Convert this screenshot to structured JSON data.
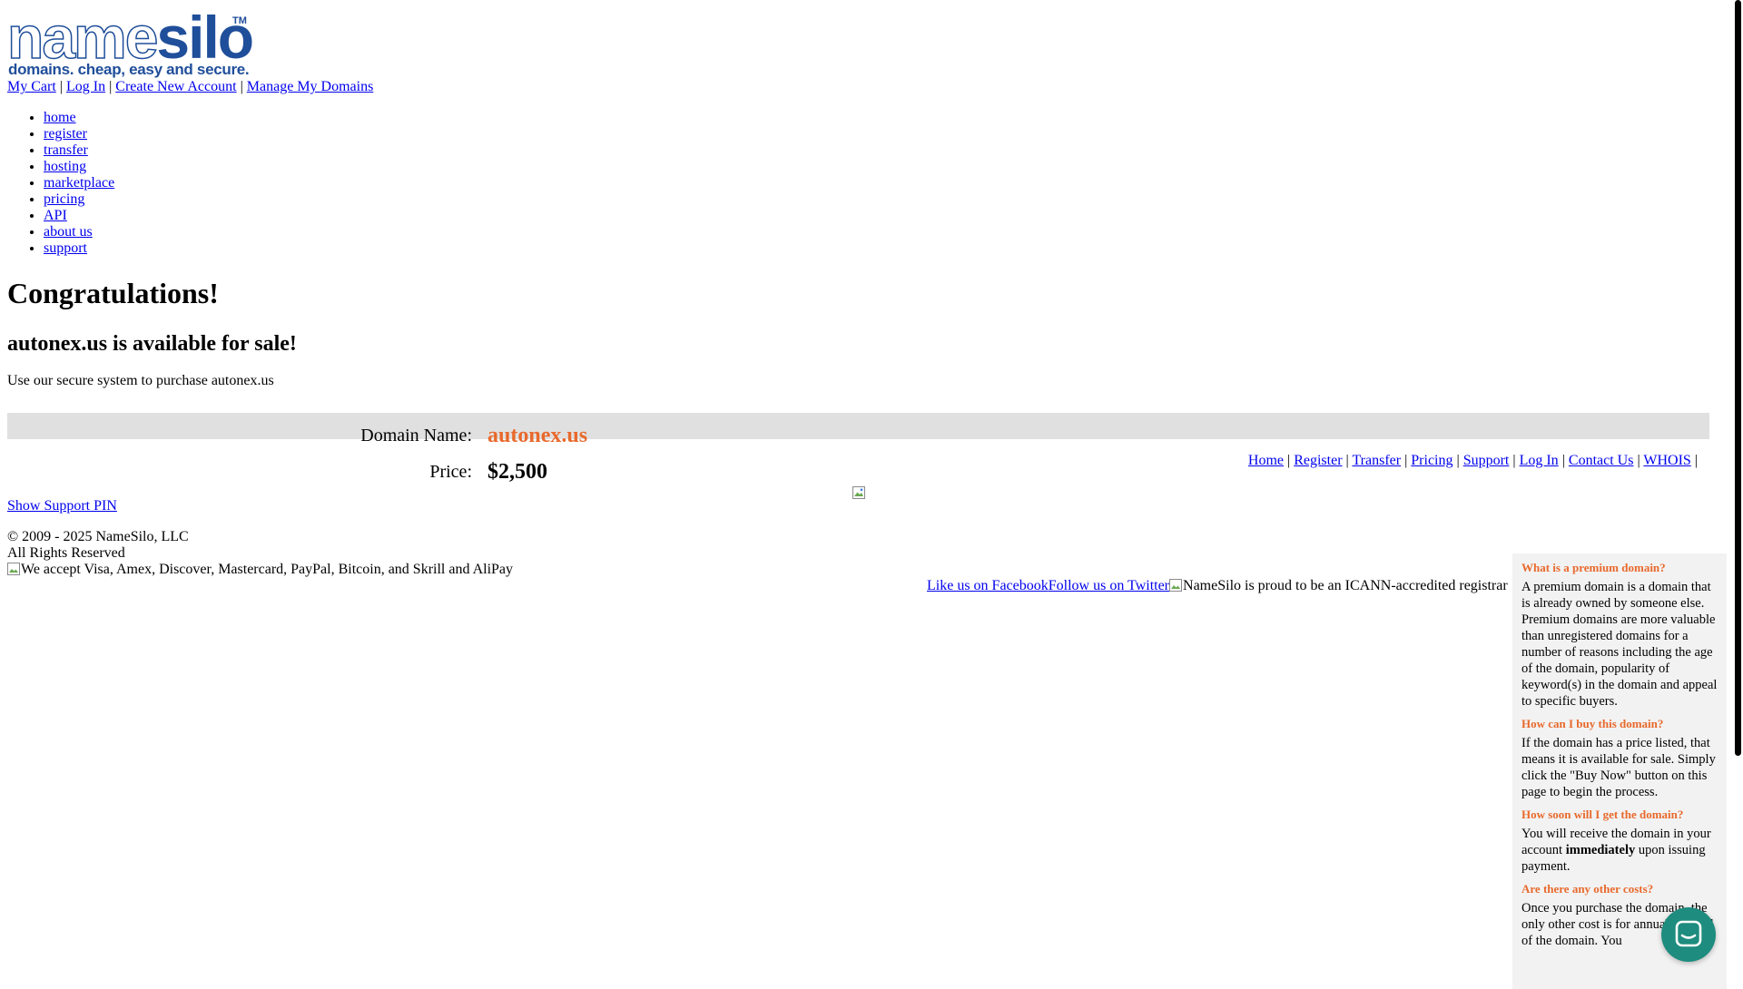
{
  "logo": {
    "wordmark_a": "name",
    "wordmark_b": "silo",
    "trademark": "TM",
    "tagline": "domains. cheap, easy and secure."
  },
  "top_nav": {
    "items": [
      "My Cart",
      "Log In",
      "Create New Account",
      "Manage My Domains"
    ],
    "separator": "|"
  },
  "main_nav": {
    "items": [
      "home",
      "register",
      "transfer",
      "hosting",
      "marketplace",
      "pricing",
      "API",
      "about us",
      "support"
    ]
  },
  "content": {
    "heading": "Congratulations!",
    "subheading": "autonex.us is available for sale!",
    "intro": "Use our secure system to purchase autonex.us",
    "domain_label": "Domain Name:",
    "domain_value": "autonex.us",
    "price_label": "Price:",
    "price_value": "$2,500"
  },
  "footer": {
    "links": [
      "Home",
      "Register",
      "Transfer",
      "Pricing",
      "Support",
      "Log In",
      "Contact Us",
      "WHOIS"
    ],
    "separator": "|",
    "support_pin": "Show Support PIN",
    "copyright": "© 2009 - 2025 NameSilo, LLC",
    "rights": "All Rights Reserved",
    "payments_alt": "We accept Visa, Amex, Discover, Mastercard, PayPal, Bitcoin, and Skrill and AliPay",
    "facebook": "Like us on Facebook",
    "twitter": "Follow us on Twitter",
    "icann_alt": "NameSilo is proud to be an ICANN-accredited registrar"
  },
  "faq": [
    {
      "question": "What is a premium domain?",
      "answer": "A premium domain is a domain that is already owned by someone else. Premium domains are more valuable than unregistered domains for a number of reasons including the age of the domain, popularity of keyword(s) in the domain and appeal to specific buyers."
    },
    {
      "question": "How can I buy this domain?",
      "answer": "If the domain has a price listed, that means it is available for sale. Simply click the \"Buy Now\" button on this page to begin the process."
    },
    {
      "question": "How soon will I get the domain?",
      "answer_pre": "You will receive the domain in your account ",
      "answer_bold": "immediately",
      "answer_post": " upon issuing payment."
    },
    {
      "question": "Are there any other costs?",
      "answer": "Once you purchase the domain, the only other cost is for annual renewal of the domain. You"
    }
  ],
  "icons": {
    "broken_image": "broken-image-icon",
    "chat": "chat-bubble-icon"
  },
  "colors": {
    "link": "#0000ee",
    "accent": "#e8692c",
    "brand": "#1f4e9a",
    "chat": "#1e8c7e",
    "bar": "#e0e0e0"
  }
}
